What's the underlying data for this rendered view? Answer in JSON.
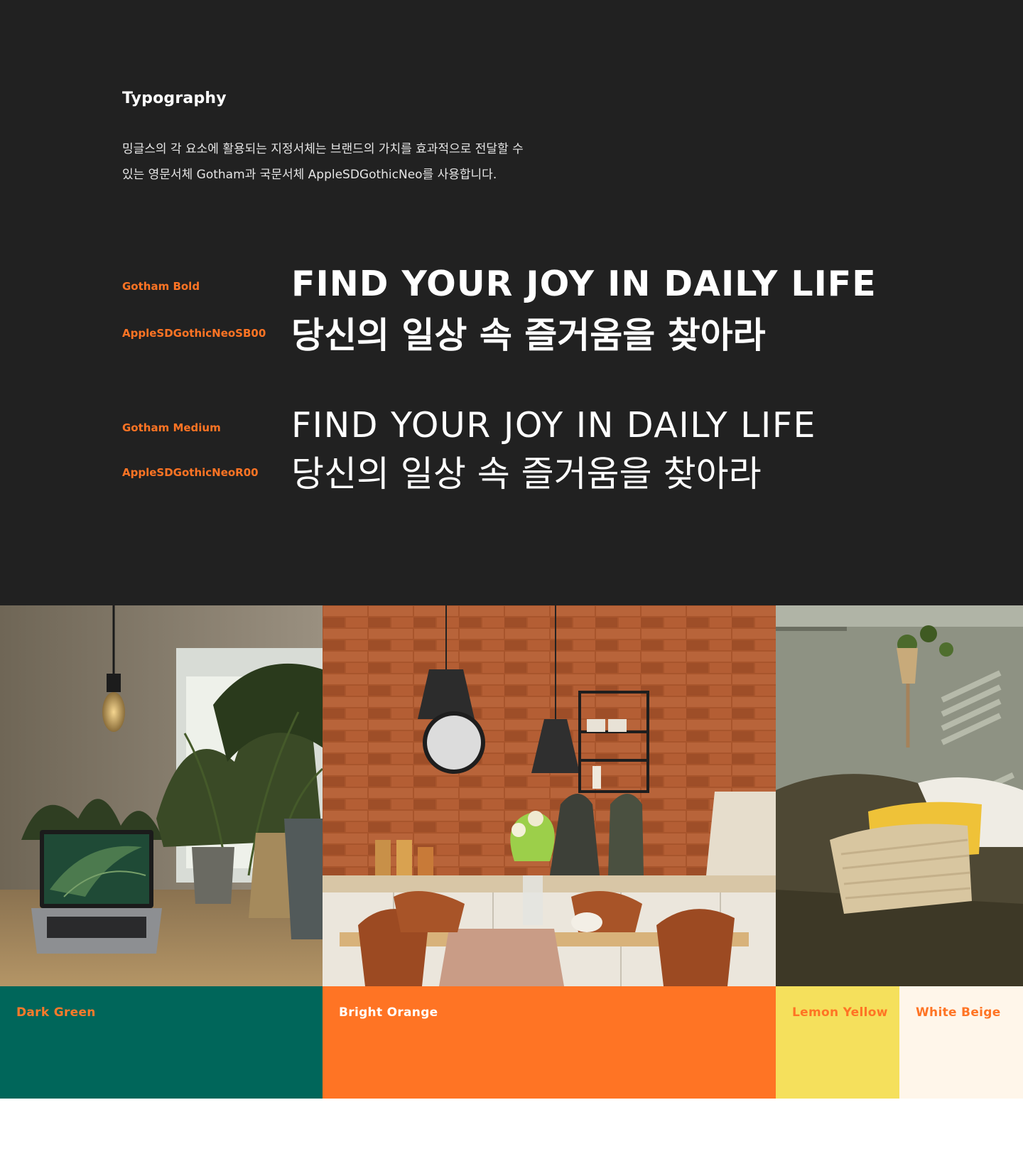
{
  "typography": {
    "heading": "Typography",
    "description_line1": "밍글스의 각 요소에 활용되는 지정서체는 브랜드의 가치를 효과적으로 전달할 수",
    "description_line2": "있는 영문서체 Gotham과 국문서체 AppleSDGothicNeo를 사용합니다.",
    "specimens": [
      {
        "label": "Gotham Bold",
        "sample": "FIND YOUR JOY IN DAILY LIFE"
      },
      {
        "label": "AppleSDGothicNeoSB00",
        "sample": "당신의 일상 속 즐거움을 찾아라"
      },
      {
        "label": "Gotham Medium",
        "sample": "FIND YOUR JOY IN DAILY LIFE"
      },
      {
        "label": "AppleSDGothicNeoR00",
        "sample": "당신의 일상 속 즐거움을 찾아라"
      }
    ]
  },
  "palette": [
    {
      "name": "Dark Green",
      "color": "#00665a",
      "label_color": "#ff7a2a"
    },
    {
      "name": "Bright Orange",
      "color": "#ff7424",
      "label_color": "#ffffff"
    },
    {
      "name": "Lemon Yellow",
      "color": "#f5e05c",
      "label_color": "#ff7424"
    },
    {
      "name": "White Beige",
      "color": "#fff6ea",
      "label_color": "#ff7424"
    }
  ],
  "colors": {
    "background_dark": "#212121",
    "accent": "#ff7424"
  }
}
